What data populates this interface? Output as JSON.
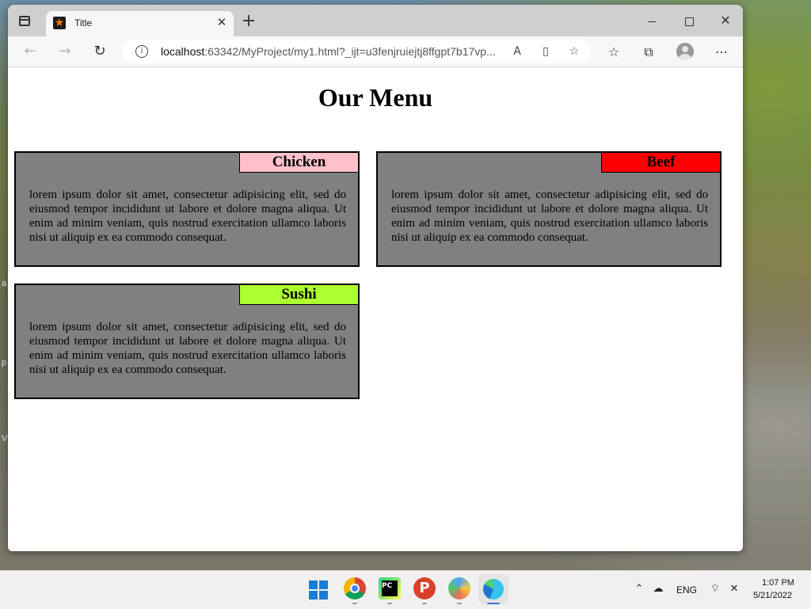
{
  "browser": {
    "tab_title": "Title",
    "url_host": "localhost",
    "url_rest": ":63342/MyProject/my1.html?_ijt=u3fenjruiejtj8ffgpt7b17vp...",
    "icons": {
      "tabs": "vertical-tabs-icon",
      "favicon": "star-favicon",
      "close_tab": "close-icon",
      "new_tab": "plus-icon",
      "back": "back-arrow-icon",
      "forward": "forward-arrow-icon",
      "reload": "reload-icon",
      "info": "info-icon",
      "read_aloud": "read-aloud-icon",
      "immersive": "immersive-reader-icon",
      "add_favorite": "add-favorite-icon",
      "favorites": "favorites-icon",
      "collections": "collections-icon",
      "profile": "profile-icon",
      "more": "more-icon"
    }
  },
  "page": {
    "title": "Our Menu",
    "cards": [
      {
        "tag": "Chicken",
        "tag_color": "#ffc0cb",
        "text": "lorem ipsum dolor sit amet, consectetur adipisicing elit, sed do eiusmod tempor incididunt ut labore et dolore magna aliqua. Ut enim ad minim veniam, quis nostrud exercitation ullamco laboris nisi ut aliquip ex ea commodo consequat."
      },
      {
        "tag": "Beef",
        "tag_color": "#ff0000",
        "text": "lorem ipsum dolor sit amet, consectetur adipisicing elit, sed do eiusmod tempor incididunt ut labore et dolore magna aliqua. Ut enim ad minim veniam, quis nostrud exercitation ullamco laboris nisi ut aliquip ex ea commodo consequat."
      },
      {
        "tag": "Sushi",
        "tag_color": "#adff2f",
        "text": "lorem ipsum dolor sit amet, consectetur adipisicing elit, sed do eiusmod tempor incididunt ut labore et dolore magna aliqua. Ut enim ad minim veniam, quis nostrud exercitation ullamco laboris nisi ut aliquip ex ea commodo consequat."
      }
    ],
    "card_bg": "#808080"
  },
  "taskbar": {
    "apps": [
      "windows-start-icon",
      "chrome-icon",
      "pycharm-icon",
      "p-app-icon",
      "paint-icon",
      "edge-icon"
    ],
    "lang": "ENG",
    "time": "1:07 PM",
    "date": "5/21/2022"
  }
}
